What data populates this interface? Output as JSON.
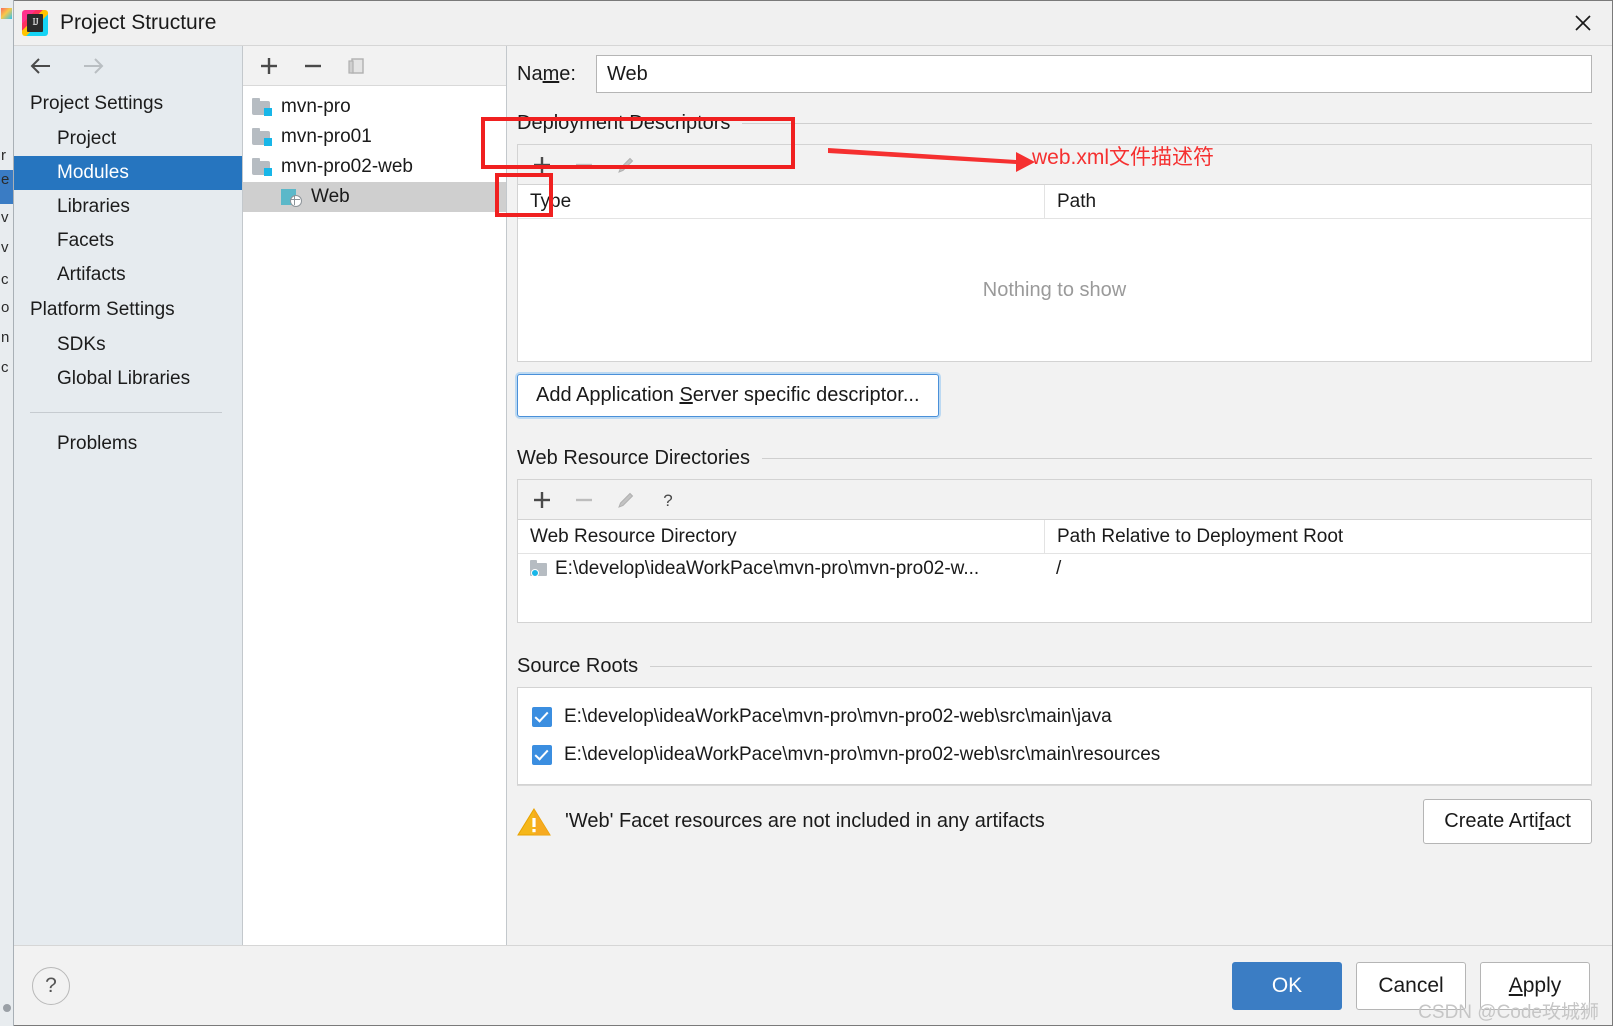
{
  "window": {
    "title": "Project Structure",
    "app_icon": "intellij-idea-icon",
    "close_icon": "close-icon"
  },
  "sidebar": {
    "back_icon": "arrow-left-icon",
    "forward_icon": "arrow-right-icon",
    "groups": [
      {
        "label": "Project Settings",
        "items": [
          {
            "label": "Project",
            "selected": false
          },
          {
            "label": "Modules",
            "selected": true
          },
          {
            "label": "Libraries",
            "selected": false
          },
          {
            "label": "Facets",
            "selected": false
          },
          {
            "label": "Artifacts",
            "selected": false
          }
        ]
      },
      {
        "label": "Platform Settings",
        "items": [
          {
            "label": "SDKs",
            "selected": false
          },
          {
            "label": "Global Libraries",
            "selected": false
          }
        ]
      }
    ],
    "problems_label": "Problems"
  },
  "tree_panel": {
    "toolbar": [
      {
        "name": "add-module-button",
        "glyph": "plus-icon"
      },
      {
        "name": "remove-module-button",
        "glyph": "minus-icon"
      },
      {
        "name": "copy-module-button",
        "glyph": "copy-icon"
      }
    ],
    "items": [
      {
        "label": "mvn-pro",
        "kind": "module",
        "selected": false
      },
      {
        "label": "mvn-pro01",
        "kind": "module",
        "selected": false
      },
      {
        "label": "mvn-pro02-web",
        "kind": "module",
        "selected": false
      },
      {
        "label": "Web",
        "kind": "facet",
        "selected": true
      }
    ]
  },
  "content": {
    "name_label_pre": "Na",
    "name_label_accel": "m",
    "name_label_post": "e:",
    "name_value": "Web",
    "name_placeholder": "",
    "deployment": {
      "section_title": "Deployment Descriptors",
      "toolbar": [
        {
          "name": "add-descriptor-button",
          "glyph": "plus-icon",
          "enabled": true
        },
        {
          "name": "remove-descriptor-button",
          "glyph": "minus-icon",
          "enabled": false
        },
        {
          "name": "edit-descriptor-button",
          "glyph": "pencil-icon",
          "enabled": false
        }
      ],
      "columns": [
        "Type",
        "Path"
      ],
      "empty_text": "Nothing to show",
      "rows": []
    },
    "add_appserver_button": {
      "pre": "Add Application ",
      "accel": "S",
      "post": "erver specific descriptor..."
    },
    "web_resources": {
      "section_title": "Web Resource Directories",
      "toolbar": [
        {
          "name": "add-web-resource-button",
          "glyph": "plus-icon",
          "enabled": true
        },
        {
          "name": "remove-web-resource-button",
          "glyph": "minus-icon",
          "enabled": false
        },
        {
          "name": "edit-web-resource-button",
          "glyph": "pencil-icon",
          "enabled": false
        },
        {
          "name": "web-resource-help-button",
          "glyph": "question-icon",
          "enabled": true
        }
      ],
      "columns": [
        "Web Resource Directory",
        "Path Relative to Deployment Root"
      ],
      "rows": [
        {
          "directory": "E:\\develop\\ideaWorkPace\\mvn-pro\\mvn-pro02-w...",
          "relative_path": "/"
        }
      ]
    },
    "source_roots": {
      "section_title": "Source Roots",
      "items": [
        {
          "checked": true,
          "path": "E:\\develop\\ideaWorkPace\\mvn-pro\\mvn-pro02-web\\src\\main\\java"
        },
        {
          "checked": true,
          "path": "E:\\develop\\ideaWorkPace\\mvn-pro\\mvn-pro02-web\\src\\main\\resources"
        }
      ]
    },
    "warning": {
      "icon": "warning-triangle-icon",
      "text": "'Web' Facet resources are not included in any artifacts",
      "action_pre": "Create Arti",
      "action_accel": "f",
      "action_post": "act"
    }
  },
  "footer": {
    "help_label": "?",
    "ok_label": "OK",
    "cancel_label": "Cancel",
    "apply_pre": "",
    "apply_accel": "A",
    "apply_post": "pply"
  },
  "annotations": {
    "arrow_color": "#f53030",
    "box_color": "#f02020",
    "note_text": "web.xml文件描述符"
  },
  "watermark": "CSDN @Code攻城狮"
}
